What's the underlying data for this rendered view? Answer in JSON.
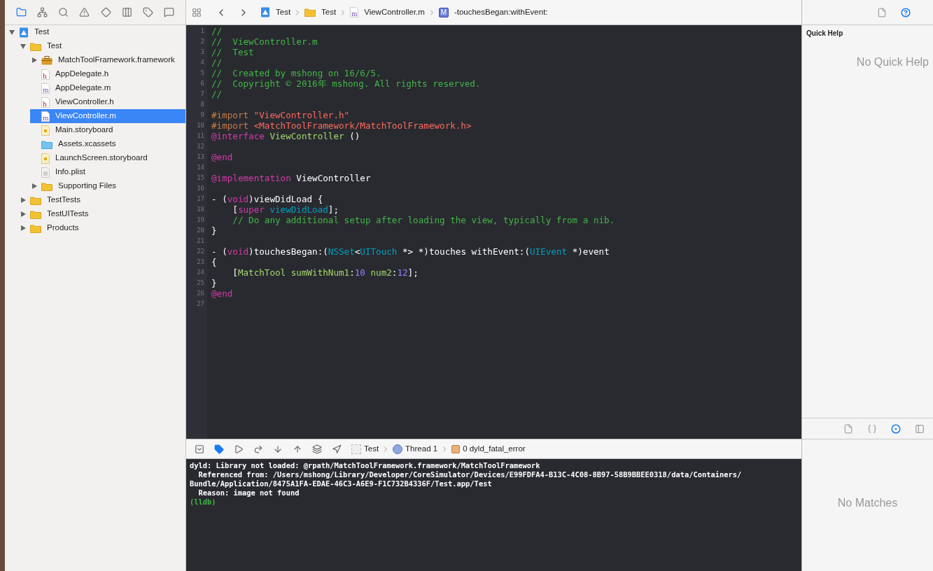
{
  "navigator_toolbar": [
    {
      "kind": "folder",
      "selected": true
    },
    {
      "kind": "hierarchy",
      "selected": false
    },
    {
      "kind": "search",
      "selected": false
    },
    {
      "kind": "warning",
      "selected": false
    },
    {
      "kind": "diamond",
      "selected": false
    },
    {
      "kind": "table",
      "selected": false
    },
    {
      "kind": "tag",
      "selected": false
    },
    {
      "kind": "message",
      "selected": false
    }
  ],
  "navigator": [
    {
      "label": "Test",
      "kind": "project",
      "expanded": true,
      "selected": false,
      "children": [
        {
          "label": "Test",
          "kind": "folder",
          "expanded": true,
          "selected": false,
          "children": [
            {
              "label": "MatchToolFramework.framework",
              "kind": "framework",
              "expanded": false,
              "selected": false
            },
            {
              "label": "AppDelegate.h",
              "kind": "header",
              "glyph": "h",
              "selected": false
            },
            {
              "label": "AppDelegate.m",
              "kind": "source",
              "glyph": "m",
              "selected": false
            },
            {
              "label": "ViewController.h",
              "kind": "header",
              "glyph": "h",
              "selected": false
            },
            {
              "label": "ViewController.m",
              "kind": "source",
              "glyph": "m",
              "selected": true
            },
            {
              "label": "Main.storyboard",
              "kind": "storyboard",
              "selected": false
            },
            {
              "label": "Assets.xcassets",
              "kind": "assets",
              "selected": false
            },
            {
              "label": "LaunchScreen.storyboard",
              "kind": "storyboard",
              "selected": false
            },
            {
              "label": "Info.plist",
              "kind": "plist",
              "selected": false
            },
            {
              "label": "Supporting Files",
              "kind": "folder",
              "expanded": false,
              "selected": false
            }
          ]
        },
        {
          "label": "TestTests",
          "kind": "folder",
          "expanded": false,
          "selected": false
        },
        {
          "label": "TestUITests",
          "kind": "folder",
          "expanded": false,
          "selected": false
        },
        {
          "label": "Products",
          "kind": "folder",
          "expanded": false,
          "selected": false
        }
      ]
    }
  ],
  "jump_bar": [
    {
      "label": "Test",
      "kind": "project"
    },
    {
      "label": "Test",
      "kind": "folder"
    },
    {
      "label": "ViewController.m",
      "kind": "source",
      "glyph": "m"
    },
    {
      "label": "-touchesBegan:withEvent:",
      "kind": "method",
      "badge": "M"
    }
  ],
  "code": [
    {
      "number": "1",
      "tokens": [
        {
          "kind": "comment",
          "text": "//"
        }
      ]
    },
    {
      "number": "2",
      "tokens": [
        {
          "kind": "comment",
          "text": "//  ViewController.m"
        }
      ]
    },
    {
      "number": "3",
      "tokens": [
        {
          "kind": "comment",
          "text": "//  Test"
        }
      ]
    },
    {
      "number": "4",
      "tokens": [
        {
          "kind": "comment",
          "text": "//"
        }
      ]
    },
    {
      "number": "5",
      "tokens": [
        {
          "kind": "comment",
          "text": "//  Created by mshong on 16/6/5."
        }
      ]
    },
    {
      "number": "6",
      "tokens": [
        {
          "kind": "comment",
          "text": "//  Copyright © 2016年 mshong. All rights reserved."
        }
      ]
    },
    {
      "number": "7",
      "tokens": [
        {
          "kind": "comment",
          "text": "//"
        }
      ]
    },
    {
      "number": "8"
    },
    {
      "number": "9",
      "tokens": [
        {
          "kind": "preproc",
          "text": "#import "
        },
        {
          "kind": "string",
          "text": "\"ViewController.h\""
        }
      ]
    },
    {
      "number": "10",
      "tokens": [
        {
          "kind": "preproc",
          "text": "#import "
        },
        {
          "kind": "string",
          "text": "<MatchToolFramework/MatchToolFramework.h>"
        }
      ]
    },
    {
      "number": "11",
      "tokens": [
        {
          "kind": "keyword",
          "text": "@interface"
        },
        {
          "kind": "project",
          "text": " ViewController"
        },
        {
          "kind": "plain",
          "text": " ()"
        }
      ]
    },
    {
      "number": "12"
    },
    {
      "number": "13",
      "tokens": [
        {
          "kind": "keyword",
          "text": "@end"
        }
      ]
    },
    {
      "number": "14"
    },
    {
      "number": "15",
      "tokens": [
        {
          "kind": "keyword",
          "text": "@implementation"
        },
        {
          "kind": "plain",
          "text": " ViewController"
        }
      ]
    },
    {
      "number": "16"
    },
    {
      "number": "17",
      "tokens": [
        {
          "kind": "plain",
          "text": "- ("
        },
        {
          "kind": "keyword",
          "text": "void"
        },
        {
          "kind": "plain",
          "text": ")viewDidLoad {"
        }
      ]
    },
    {
      "number": "18",
      "tokens": [
        {
          "kind": "plain",
          "text": "    ["
        },
        {
          "kind": "keyword",
          "text": "super"
        },
        {
          "kind": "system",
          "text": " viewDidLoad"
        },
        {
          "kind": "plain",
          "text": "];"
        }
      ]
    },
    {
      "number": "19",
      "tokens": [
        {
          "kind": "comment",
          "text": "    // Do any additional setup after loading the view, typically from a nib."
        }
      ]
    },
    {
      "number": "20",
      "tokens": [
        {
          "kind": "plain",
          "text": "}"
        }
      ]
    },
    {
      "number": "21"
    },
    {
      "number": "22",
      "tokens": [
        {
          "kind": "plain",
          "text": "- ("
        },
        {
          "kind": "keyword",
          "text": "void"
        },
        {
          "kind": "plain",
          "text": ")touchesBegan:("
        },
        {
          "kind": "system",
          "text": "NSSet"
        },
        {
          "kind": "plain",
          "text": "<"
        },
        {
          "kind": "system",
          "text": "UITouch"
        },
        {
          "kind": "plain",
          "text": " *> *)touches withEvent:("
        },
        {
          "kind": "system",
          "text": "UIEvent"
        },
        {
          "kind": "plain",
          "text": " *)event"
        }
      ]
    },
    {
      "number": "23",
      "tokens": [
        {
          "kind": "plain",
          "text": "{"
        }
      ]
    },
    {
      "number": "24",
      "tokens": [
        {
          "kind": "plain",
          "text": "    ["
        },
        {
          "kind": "project",
          "text": "MatchTool sumWithNum1"
        },
        {
          "kind": "plain",
          "text": ":"
        },
        {
          "kind": "number",
          "text": "10"
        },
        {
          "kind": "project",
          "text": " num2"
        },
        {
          "kind": "plain",
          "text": ":"
        },
        {
          "kind": "number",
          "text": "12"
        },
        {
          "kind": "plain",
          "text": "];"
        }
      ]
    },
    {
      "number": "25",
      "tokens": [
        {
          "kind": "plain",
          "text": "}"
        }
      ]
    },
    {
      "number": "26",
      "tokens": [
        {
          "kind": "keyword",
          "text": "@end"
        }
      ]
    },
    {
      "number": "27"
    }
  ],
  "debug_bar": {
    "buttons": [
      {
        "kind": "panel",
        "active": false
      },
      {
        "kind": "breakpoints",
        "active": true
      },
      {
        "kind": "continue",
        "active": false
      },
      {
        "kind": "step-over",
        "active": false
      },
      {
        "kind": "step-into",
        "active": false
      },
      {
        "kind": "step-out",
        "active": false
      },
      {
        "kind": "view-debugger",
        "active": false
      },
      {
        "kind": "location",
        "active": false
      }
    ],
    "path": [
      {
        "label": "Test",
        "kind": "app"
      },
      {
        "label": "Thread 1",
        "kind": "thread"
      },
      {
        "label": "0 dyld_fatal_error",
        "kind": "frame"
      }
    ]
  },
  "console": [
    {
      "kind": "output",
      "text": "dyld: Library not loaded: @rpath/MatchToolFramework.framework/MatchToolFramework"
    },
    {
      "kind": "output",
      "text": "  Referenced from: /Users/mshong/Library/Developer/CoreSimulator/Devices/E99FDFA4-B13C-4C08-8B97-58B9BBEE0318/data/Containers/"
    },
    {
      "kind": "output",
      "text": "Bundle/Application/8475A1FA-EDAE-46C3-A6E9-F1C732B4336F/Test.app/Test"
    },
    {
      "kind": "output",
      "text": "  Reason: image not found"
    },
    {
      "kind": "prompt",
      "text": "(lldb)"
    }
  ],
  "inspector": {
    "tabs": [
      {
        "kind": "file",
        "selected": false
      },
      {
        "kind": "help",
        "selected": true
      }
    ],
    "title": "Quick Help",
    "empty": "No Quick Help"
  },
  "library": {
    "tabs": [
      {
        "kind": "file",
        "selected": false
      },
      {
        "kind": "braces",
        "selected": false
      },
      {
        "kind": "object",
        "selected": true
      },
      {
        "kind": "media",
        "selected": false
      }
    ],
    "empty": "No Matches"
  }
}
